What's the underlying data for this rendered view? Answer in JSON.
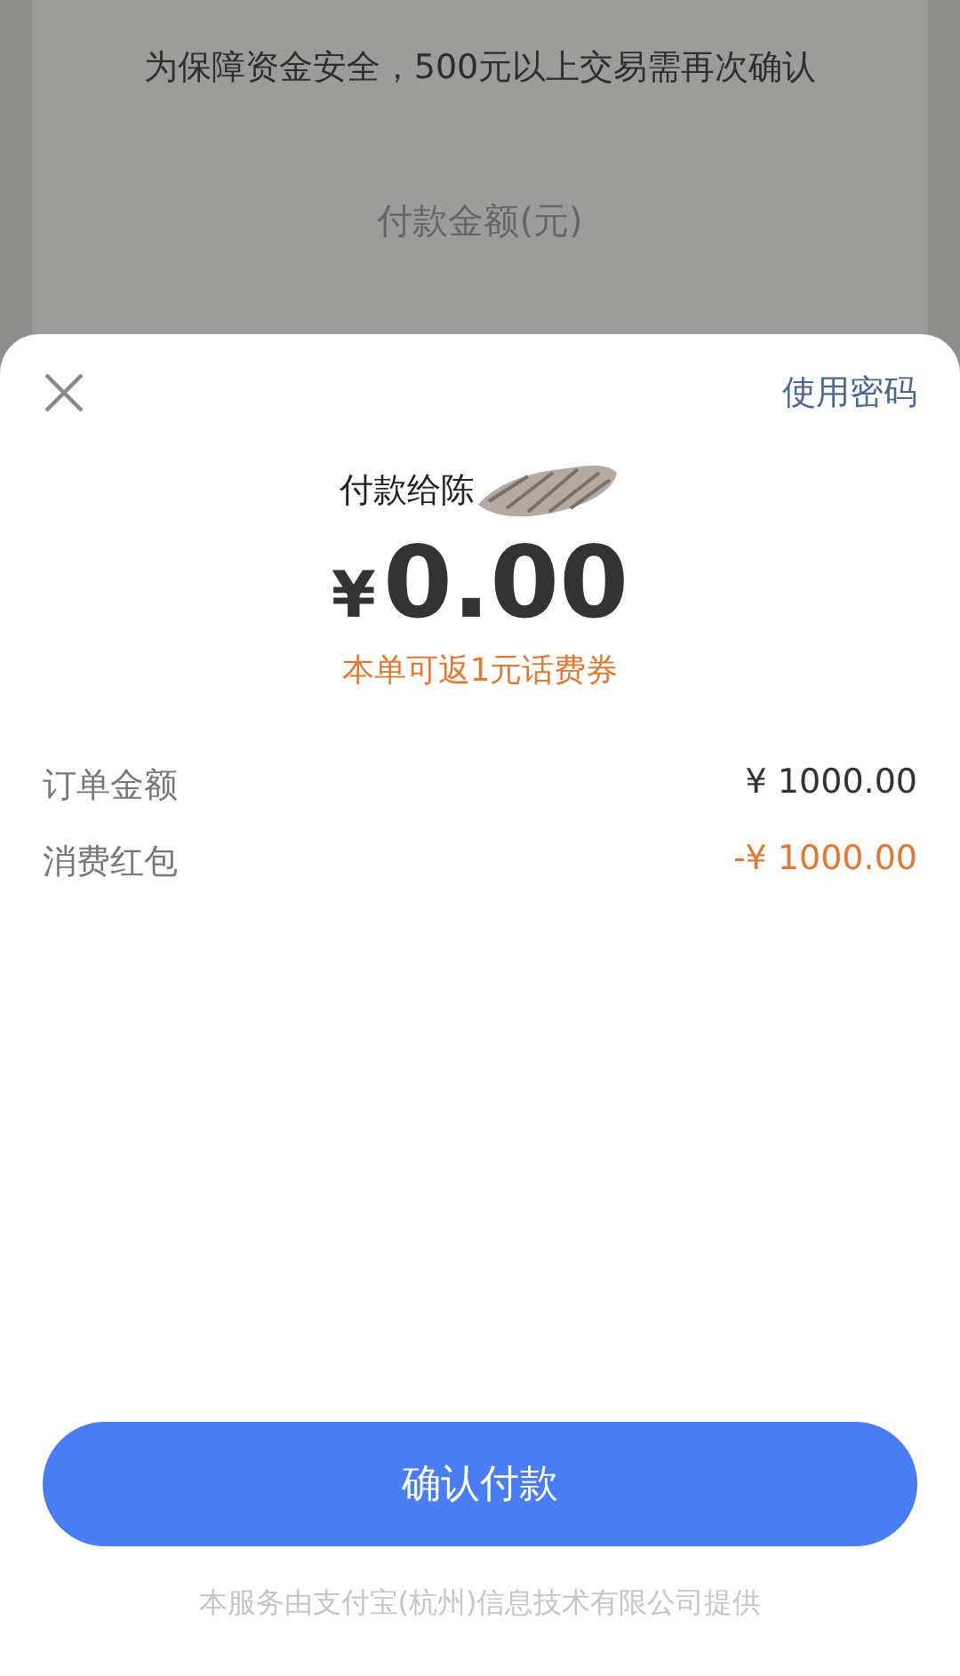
{
  "background_page": {
    "notice": "为保障资金安全，500元以上交易需再次确认",
    "amount_label": "付款金额(元)"
  },
  "sheet": {
    "use_password_link": "使用密码",
    "payee": "付款给陈",
    "payee_redacted": true,
    "amount": {
      "currency": "¥",
      "value": "0.00"
    },
    "promo": "本单可返1元话费券",
    "details": [
      {
        "label": "订单金额",
        "value": "¥ 1000.00",
        "kind": "normal"
      },
      {
        "label": "消费红包",
        "value": "-¥ 1000.00",
        "kind": "discount"
      }
    ],
    "confirm_button": "确认付款",
    "footer": "本服务由支付宝(杭州)信息技术有限公司提供"
  }
}
